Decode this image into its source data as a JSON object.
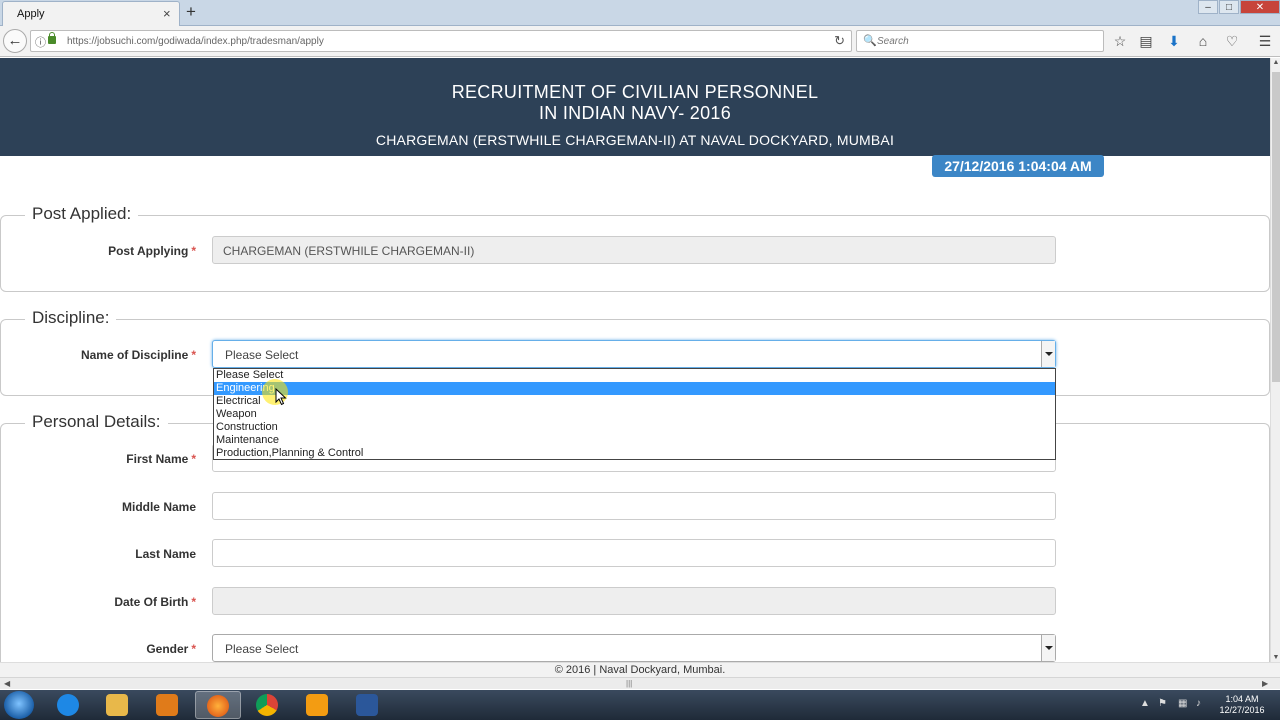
{
  "browser": {
    "tab_title": "Apply",
    "tab_close": "×",
    "new_tab": "+",
    "url": "https://jobsuchi.com/godiwada/index.php/tradesman/apply",
    "search_placeholder": "Search"
  },
  "header": {
    "line1": "RECRUITMENT OF CIVILIAN PERSONNEL",
    "line2": "IN INDIAN NAVY- 2016",
    "line3": "CHARGEMAN (ERSTWHILE CHARGEMAN-II) AT NAVAL DOCKYARD, MUMBAI",
    "datetime": "27/12/2016 1:04:04 AM"
  },
  "sections": {
    "post": {
      "legend": "Post Applied:",
      "field_label": "Post Applying",
      "field_value": "CHARGEMAN (ERSTWHILE CHARGEMAN-II)"
    },
    "discipline": {
      "legend": "Discipline:",
      "field_label": "Name of Discipline",
      "selected": "Please Select",
      "options": [
        "Please Select",
        "Engineering",
        "Electrical",
        "Weapon",
        "Construction",
        "Maintenance",
        "Production,Planning & Control"
      ],
      "highlighted_option": "Engineering"
    },
    "personal": {
      "legend": "Personal Details:",
      "first_name_label": "First Name",
      "middle_name_label": "Middle Name",
      "last_name_label": "Last Name",
      "dob_label": "Date Of Birth",
      "gender_label": "Gender",
      "gender_selected": "Please Select"
    }
  },
  "required_mark": "*",
  "footer": "© 2016 | Naval Dockyard, Mumbai.",
  "taskbar": {
    "time": "1:04 AM",
    "date": "12/27/2016"
  },
  "colors": {
    "header_bg": "#2d4157",
    "datetime_badge": "#3c86c6",
    "dropdown_highlight": "#3399ff",
    "required": "#d9534f"
  }
}
